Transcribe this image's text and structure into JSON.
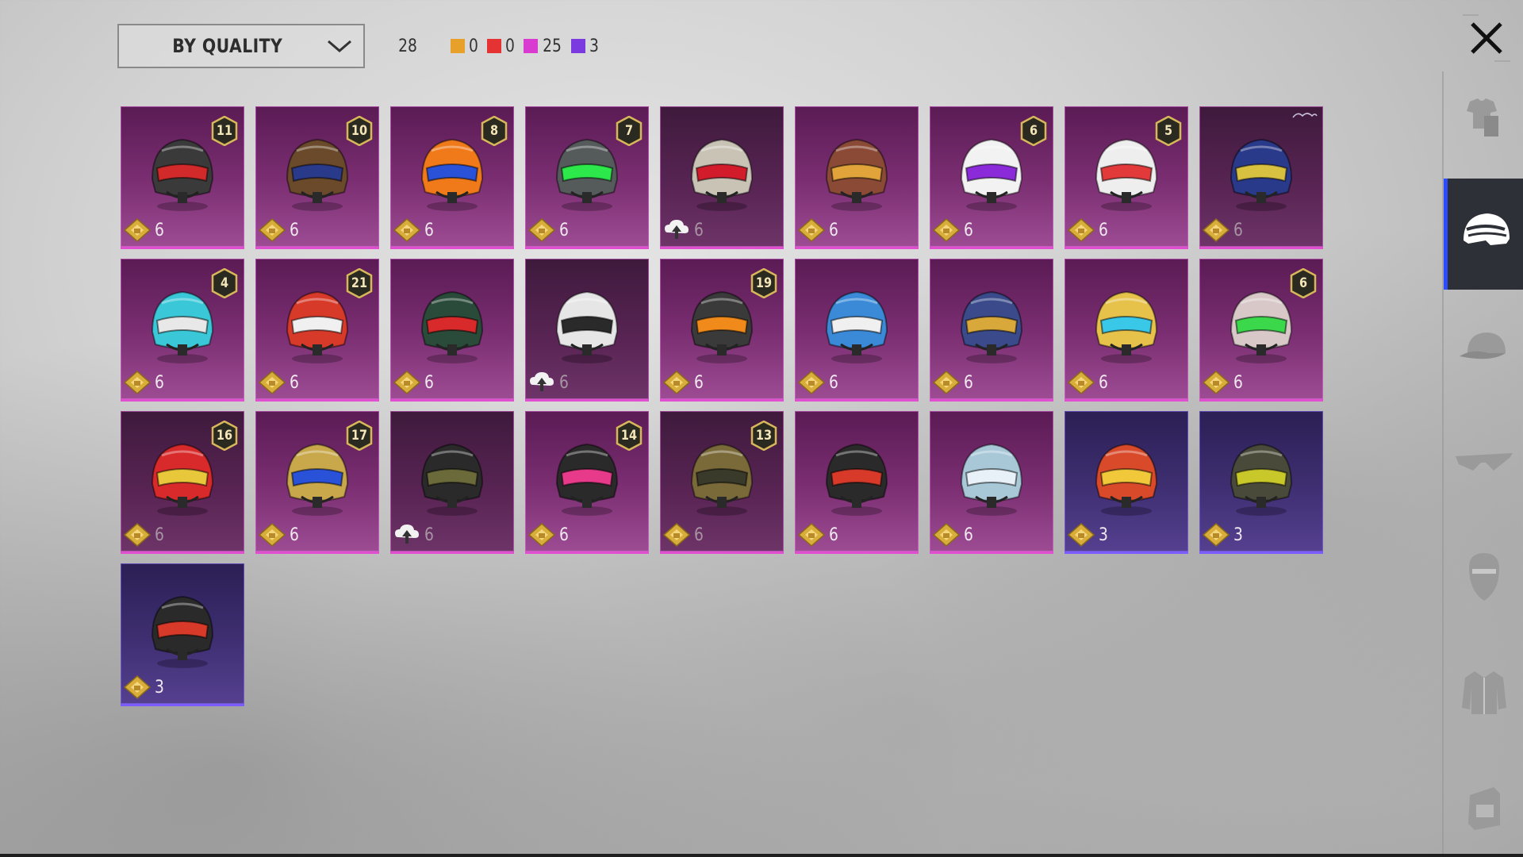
{
  "sort": {
    "label": "BY QUALITY"
  },
  "counts": {
    "total": "28",
    "items": [
      {
        "color": "#e7a12a",
        "value": "0"
      },
      {
        "color": "#e53333",
        "value": "0"
      },
      {
        "color": "#d93ad0",
        "value": "25"
      },
      {
        "color": "#7a3ae0",
        "value": "3"
      }
    ]
  },
  "cards": [
    {
      "name": "helmet-1",
      "rarity": "purple",
      "badge": "11",
      "level": "6",
      "icon": "level-icon",
      "helmet_color": "#3a3a3a",
      "accent": "#d22a2a"
    },
    {
      "name": "helmet-2",
      "rarity": "purple",
      "badge": "10",
      "level": "6",
      "icon": "level-icon",
      "helmet_color": "#6a4a2a",
      "accent": "#2a3a8a"
    },
    {
      "name": "helmet-3",
      "rarity": "purple",
      "badge": "8",
      "level": "6",
      "icon": "level-icon",
      "helmet_color": "#f07a1a",
      "accent": "#2a52d8"
    },
    {
      "name": "helmet-4",
      "rarity": "purple",
      "badge": "7",
      "level": "6",
      "icon": "level-icon",
      "helmet_color": "#555a5a",
      "accent": "#2de84a"
    },
    {
      "name": "helmet-5",
      "rarity": "purple",
      "badge": "",
      "level": "6",
      "icon": "upgrade-icon",
      "dim": true,
      "helmet_color": "#c9c3b6",
      "accent": "#d21c2c"
    },
    {
      "name": "helmet-6",
      "rarity": "purple",
      "badge": "",
      "level": "6",
      "icon": "level-icon",
      "helmet_color": "#8a4a36",
      "accent": "#e0a43a"
    },
    {
      "name": "helmet-7",
      "rarity": "purple",
      "badge": "6",
      "level": "6",
      "icon": "level-icon",
      "helmet_color": "#f2f2f2",
      "accent": "#8a2ad8"
    },
    {
      "name": "helmet-8",
      "rarity": "purple",
      "badge": "5",
      "level": "6",
      "icon": "level-icon",
      "helmet_color": "#eeeeee",
      "accent": "#e23a3a"
    },
    {
      "name": "helmet-9",
      "rarity": "purple",
      "badge": "",
      "level": "6",
      "icon": "level-icon",
      "dim": true,
      "corner_logo": true,
      "helmet_color": "#2a3a8a",
      "accent": "#d8c040"
    },
    {
      "name": "helmet-10",
      "rarity": "purple",
      "badge": "4",
      "level": "6",
      "icon": "level-icon",
      "helmet_color": "#3ac8d8",
      "accent": "#e8e8e8"
    },
    {
      "name": "helmet-11",
      "rarity": "purple",
      "badge": "21",
      "level": "6",
      "icon": "level-icon",
      "helmet_color": "#d83a2a",
      "accent": "#f0f0f0"
    },
    {
      "name": "helmet-12",
      "rarity": "purple",
      "badge": "",
      "level": "6",
      "icon": "level-icon",
      "helmet_color": "#2a4a3a",
      "accent": "#d82a2a"
    },
    {
      "name": "helmet-13",
      "rarity": "purple",
      "badge": "",
      "level": "6",
      "icon": "upgrade-icon",
      "dim": true,
      "helmet_color": "#e6e6e6",
      "accent": "#2a2a2a"
    },
    {
      "name": "helmet-14",
      "rarity": "purple",
      "badge": "19",
      "level": "6",
      "icon": "level-icon",
      "helmet_color": "#3a3a3a",
      "accent": "#f08a1a"
    },
    {
      "name": "helmet-15",
      "rarity": "purple",
      "badge": "",
      "level": "6",
      "icon": "level-icon",
      "helmet_color": "#3a8ad8",
      "accent": "#f0f0f0"
    },
    {
      "name": "helmet-16",
      "rarity": "purple",
      "badge": "",
      "level": "6",
      "icon": "level-icon",
      "helmet_color": "#3a4a8a",
      "accent": "#d8a83a"
    },
    {
      "name": "helmet-17",
      "rarity": "purple",
      "badge": "",
      "level": "6",
      "icon": "level-icon",
      "helmet_color": "#e6c24a",
      "accent": "#3ac8e8"
    },
    {
      "name": "helmet-18",
      "rarity": "purple",
      "badge": "6",
      "level": "6",
      "icon": "level-icon",
      "helmet_color": "#d8c8c8",
      "accent": "#3ad84a"
    },
    {
      "name": "helmet-19",
      "rarity": "purple",
      "badge": "16",
      "level": "6",
      "icon": "level-icon",
      "dim": true,
      "helmet_color": "#d82a2a",
      "accent": "#e8c83a"
    },
    {
      "name": "helmet-20",
      "rarity": "purple",
      "badge": "17",
      "level": "6",
      "icon": "level-icon",
      "helmet_color": "#c8a84a",
      "accent": "#2a52d8"
    },
    {
      "name": "helmet-21",
      "rarity": "purple",
      "badge": "",
      "level": "6",
      "icon": "upgrade-icon",
      "dim": true,
      "helmet_color": "#2a2a2a",
      "accent": "#6a6a3a"
    },
    {
      "name": "helmet-22",
      "rarity": "purple",
      "badge": "14",
      "level": "6",
      "icon": "level-icon",
      "helmet_color": "#2a2a2a",
      "accent": "#e83a8a"
    },
    {
      "name": "helmet-23",
      "rarity": "purple",
      "badge": "13",
      "level": "6",
      "icon": "level-icon",
      "dim": true,
      "helmet_color": "#7a6a3a",
      "accent": "#3a3a2a"
    },
    {
      "name": "helmet-24",
      "rarity": "purple",
      "badge": "",
      "level": "6",
      "icon": "level-icon",
      "helmet_color": "#2a2a2a",
      "accent": "#d83a2a"
    },
    {
      "name": "helmet-25",
      "rarity": "purple",
      "badge": "",
      "level": "6",
      "icon": "level-icon",
      "helmet_color": "#a8c8d8",
      "accent": "#e8f0f8"
    },
    {
      "name": "helmet-26",
      "rarity": "blue",
      "badge": "",
      "level": "3",
      "icon": "level-icon",
      "helmet_color": "#d84a2a",
      "accent": "#f0c83a"
    },
    {
      "name": "helmet-27",
      "rarity": "blue",
      "badge": "",
      "level": "3",
      "icon": "level-icon",
      "helmet_color": "#4a4a3a",
      "accent": "#c8c82a"
    },
    {
      "name": "helmet-28",
      "rarity": "blue",
      "badge": "",
      "level": "3",
      "icon": "level-icon",
      "helmet_color": "#2a2a2a",
      "accent": "#d83a2a"
    }
  ],
  "sidebar": [
    {
      "name": "outfit-tab",
      "icon": "outfit-icon"
    },
    {
      "name": "helmet-tab",
      "icon": "helmet-icon",
      "active": true
    },
    {
      "name": "hat-tab",
      "icon": "cap-icon"
    },
    {
      "name": "glasses-tab",
      "icon": "glasses-icon"
    },
    {
      "name": "mask-tab",
      "icon": "mask-icon"
    },
    {
      "name": "jacket-tab",
      "icon": "jacket-icon"
    },
    {
      "name": "backpack-tab",
      "icon": "backpack-icon"
    }
  ]
}
